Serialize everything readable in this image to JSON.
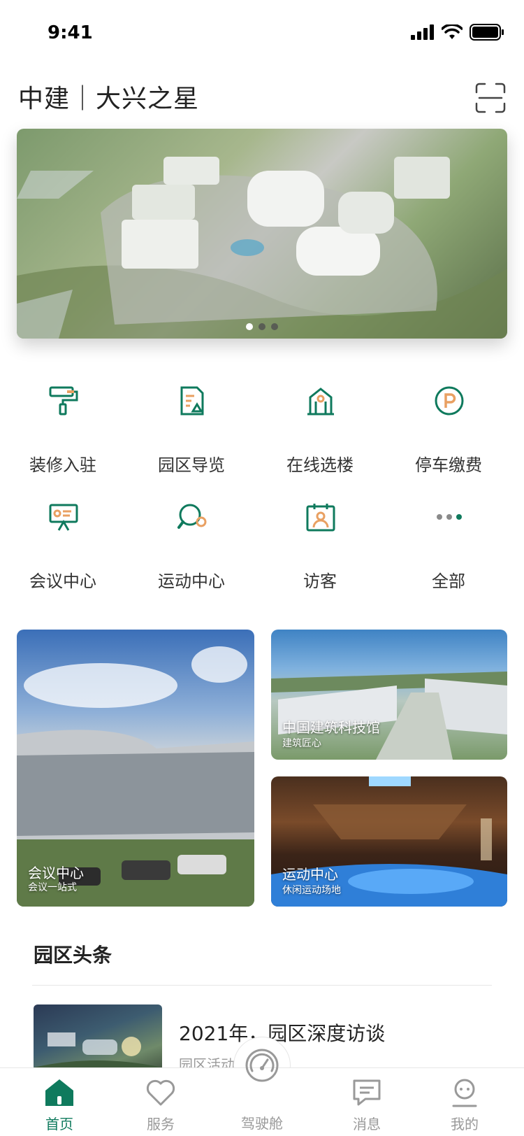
{
  "status_bar": {
    "time": "9:41"
  },
  "header": {
    "title": "中建｜大兴之星",
    "scan_icon": "scan-icon"
  },
  "banner": {
    "slide_count": 3,
    "active_index": 0
  },
  "quick_actions": [
    {
      "label": "装修入驻",
      "icon": "paint-roller-icon"
    },
    {
      "label": "园区导览",
      "icon": "map-document-icon"
    },
    {
      "label": "在线选楼",
      "icon": "building-icon"
    },
    {
      "label": "停车缴费",
      "icon": "parking-icon"
    },
    {
      "label": "会议中心",
      "icon": "presentation-icon"
    },
    {
      "label": "运动中心",
      "icon": "ping-pong-icon"
    },
    {
      "label": "访客",
      "icon": "visitor-badge-icon"
    },
    {
      "label": "全部",
      "icon": "more-dots-icon"
    }
  ],
  "feature_cards": [
    {
      "title": "会议中心",
      "subtitle": "会议一站式"
    },
    {
      "title": "中国建筑科技馆",
      "subtitle": "建筑匠心"
    },
    {
      "title": "运动中心",
      "subtitle": "休闲运动场地"
    }
  ],
  "news": {
    "heading": "园区头条",
    "items": [
      {
        "title": "2021年，园区深度访谈",
        "subtitle": "园区活动"
      }
    ]
  },
  "tab_bar": [
    {
      "label": "首页",
      "icon": "home-icon",
      "active": true
    },
    {
      "label": "服务",
      "icon": "heart-icon",
      "active": false
    },
    {
      "label": "驾驶舱",
      "icon": "dashboard-gauge-icon",
      "active": false
    },
    {
      "label": "消息",
      "icon": "message-icon",
      "active": false
    },
    {
      "label": "我的",
      "icon": "profile-icon",
      "active": false
    }
  ],
  "colors": {
    "accent": "#0f7a5d",
    "accent_orange": "#e9a062",
    "tab_inactive": "#999999"
  }
}
